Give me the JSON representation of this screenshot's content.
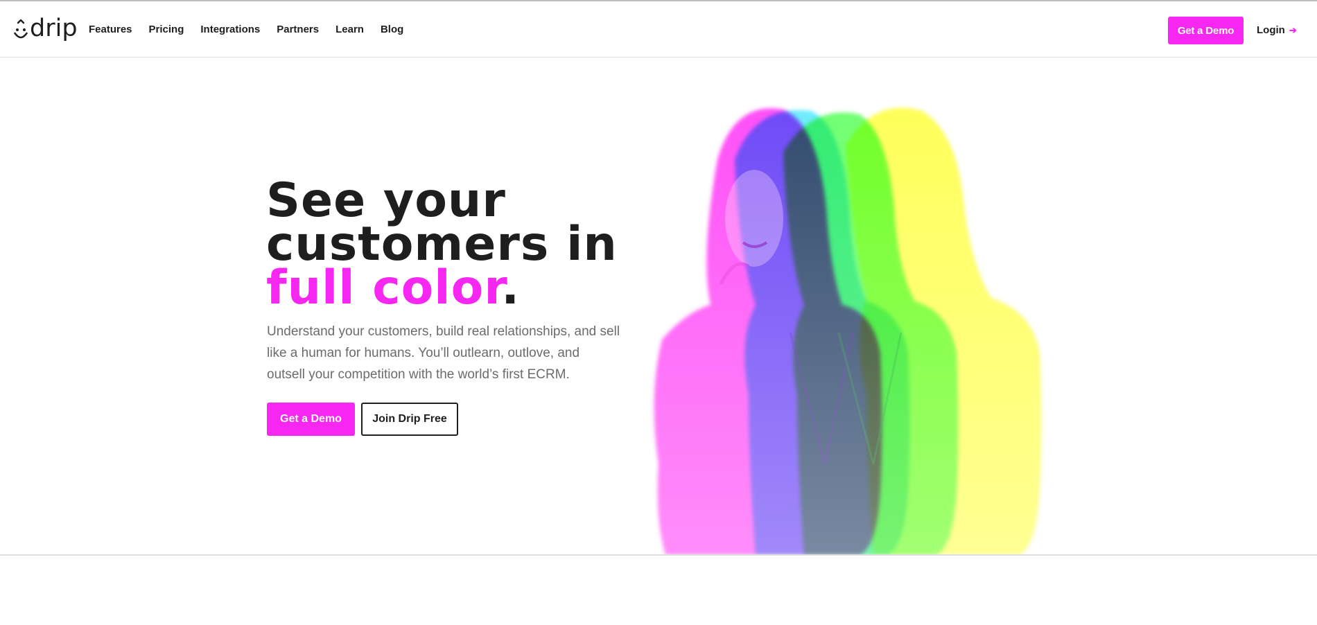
{
  "brand": {
    "name": "drip",
    "accent_color": "#f527f0",
    "text_color": "#1e1e1e"
  },
  "nav": {
    "links": [
      {
        "label": "Features"
      },
      {
        "label": "Pricing"
      },
      {
        "label": "Integrations"
      },
      {
        "label": "Partners"
      },
      {
        "label": "Learn"
      },
      {
        "label": "Blog"
      }
    ],
    "demo_button": "Get a Demo",
    "login_label": "Login",
    "login_icon": "arrow-right-icon"
  },
  "hero": {
    "title_line1": "See your",
    "title_line2": "customers in",
    "title_accent": "full color",
    "title_period": ".",
    "subtitle": "Understand your customers, build real relationships, and sell like a human for humans. You’ll outlearn, outlove, and outsell your competition with the world’s first ECRM.",
    "primary_button": "Get a Demo",
    "secondary_button": "Join Drip Free",
    "image_alt": "Woman portrait with magenta, cyan, green and yellow color-offset effect",
    "image_colors": [
      "#ff2ef5",
      "#2ee8ff",
      "#3cff3c",
      "#ffff2e"
    ]
  }
}
